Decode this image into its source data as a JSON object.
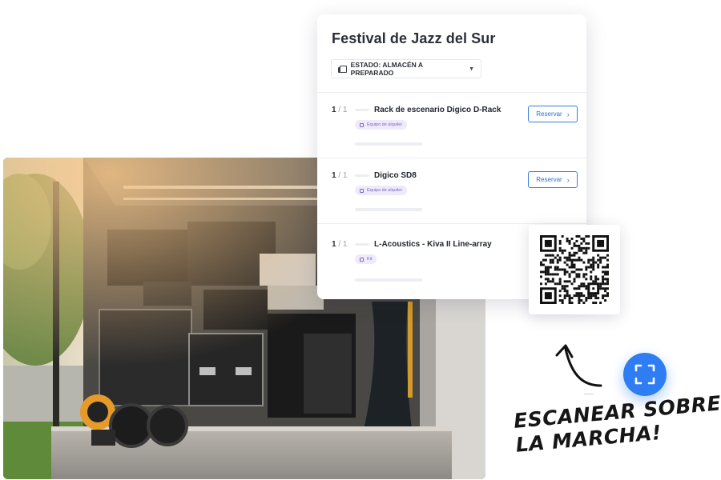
{
  "order_card": {
    "title": "Festival de Jazz del Sur",
    "status_select": {
      "label": "ESTADO: ALMACÉN A PREPARADO",
      "icon": "stack-icon"
    },
    "items": [
      {
        "qty": "1",
        "total": "1",
        "name": "Rack de escenario Digico D-Rack",
        "tag": "Equipo de alquiler",
        "tag_icon": "rental-icon",
        "action": "Reservar"
      },
      {
        "qty": "1",
        "total": "1",
        "name": "Digico SD8",
        "tag": "Equipo de alquiler",
        "tag_icon": "rental-icon",
        "action": "Reservar"
      },
      {
        "qty": "1",
        "total": "1",
        "name": "L-Acoustics - Kiva II Line-array",
        "tag": "Kit",
        "tag_icon": "kit-icon"
      }
    ],
    "separator": "/",
    "action_icon": "chevron-right-icon"
  },
  "qr": {
    "icon": "qr-code"
  },
  "scan_button": {
    "icon": "scan-frame-icon",
    "color": "#2f7df2"
  },
  "slogan": {
    "line1": "ESCANEAR SOBRE",
    "line2": "LA MARCHA!"
  },
  "photo": {
    "subject": "truck-cargo-photo"
  },
  "colors": {
    "accent": "#2f7df2",
    "tag_bg": "#eeeaf9",
    "tag_text": "#7a67c9",
    "text": "#2b2f38"
  }
}
